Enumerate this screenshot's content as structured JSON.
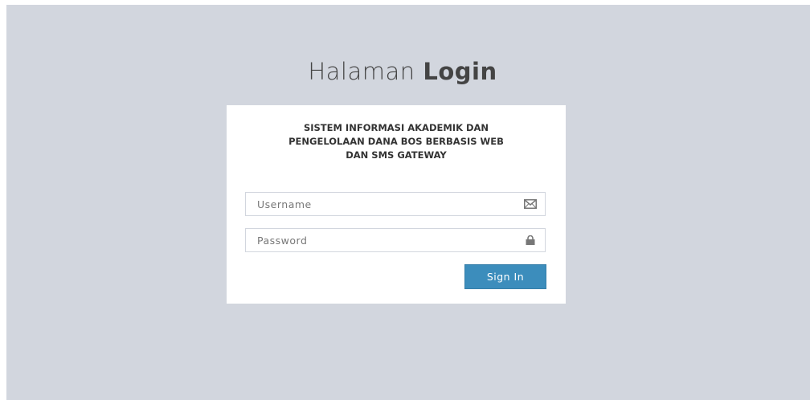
{
  "header": {
    "title_light": "Halaman",
    "title_bold": "Login"
  },
  "login_box": {
    "message_lines": [
      "SISTEM INFORMASI AKADEMIK DAN",
      "PENGELOLAAN DANA BOS BERBASIS WEB",
      "DAN SMS GATEWAY"
    ],
    "username": {
      "placeholder": "Username",
      "value": "",
      "icon": "envelope-icon"
    },
    "password": {
      "placeholder": "Password",
      "value": "",
      "icon": "lock-icon"
    },
    "signin_label": "Sign In"
  },
  "colors": {
    "background": "#d2d6de",
    "box": "#ffffff",
    "button": "#3c8dbc",
    "text": "#444444"
  }
}
